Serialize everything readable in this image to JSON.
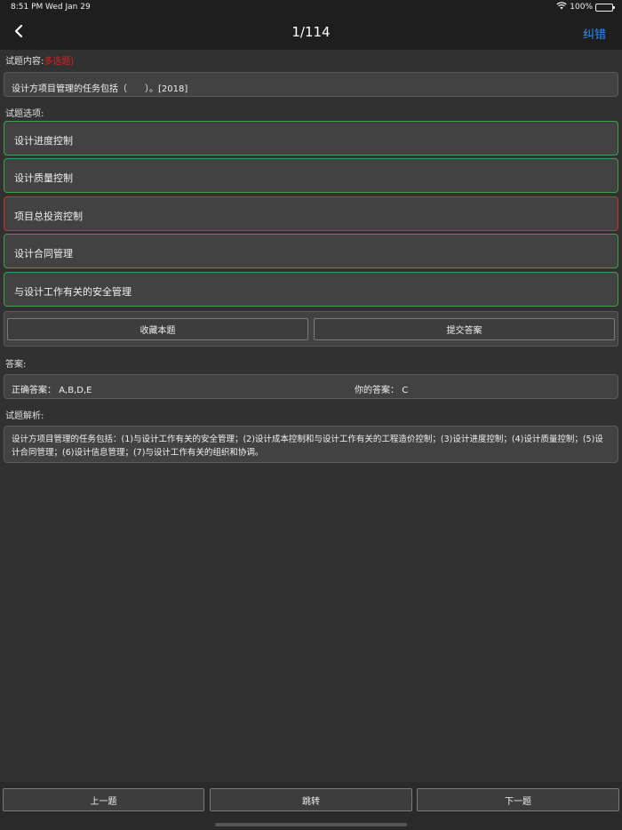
{
  "status": {
    "time": "8:51 PM",
    "date": "Wed Jan 29",
    "battery": "100%",
    "wifi_icon": "wifi-icon",
    "battery_icon": "battery-icon"
  },
  "nav": {
    "back_icon": "chevron-left-icon",
    "title": "1/114",
    "action": "纠错"
  },
  "question": {
    "label": "试题内容:",
    "type": "多选题)",
    "text": "设计方项目管理的任务包括（　　）。[2018]"
  },
  "options": {
    "label": "试题选项:",
    "items": [
      {
        "text": "设计进度控制",
        "state": "correct"
      },
      {
        "text": "设计质量控制",
        "state": "correct"
      },
      {
        "text": "项目总投资控制",
        "state": "wrong"
      },
      {
        "text": "设计合同管理",
        "state": "correct"
      },
      {
        "text": "与设计工作有关的安全管理",
        "state": "correct"
      }
    ]
  },
  "actions": {
    "favorite": "收藏本题",
    "submit": "提交答案"
  },
  "answer": {
    "label": "答案:",
    "correct_label": "正确答案：",
    "correct_value": "A,B,D,E",
    "yours_label": "你的答案：",
    "yours_value": "C"
  },
  "analysis": {
    "label": "试题解析:",
    "text": "设计方项目管理的任务包括：(1)与设计工作有关的安全管理；(2)设计成本控制和与设计工作有关的工程造价控制；(3)设计进度控制；(4)设计质量控制；(5)设计合同管理；(6)设计信息管理；(7)与设计工作有关的组织和协调。"
  },
  "bottom": {
    "prev": "上一题",
    "jump": "跳转",
    "next": "下一题"
  },
  "colors": {
    "accent": "#2f8cff",
    "correct_border": "#3f9f4a",
    "wrong_border": "#c6332c",
    "type_tag": "#e0201c"
  }
}
